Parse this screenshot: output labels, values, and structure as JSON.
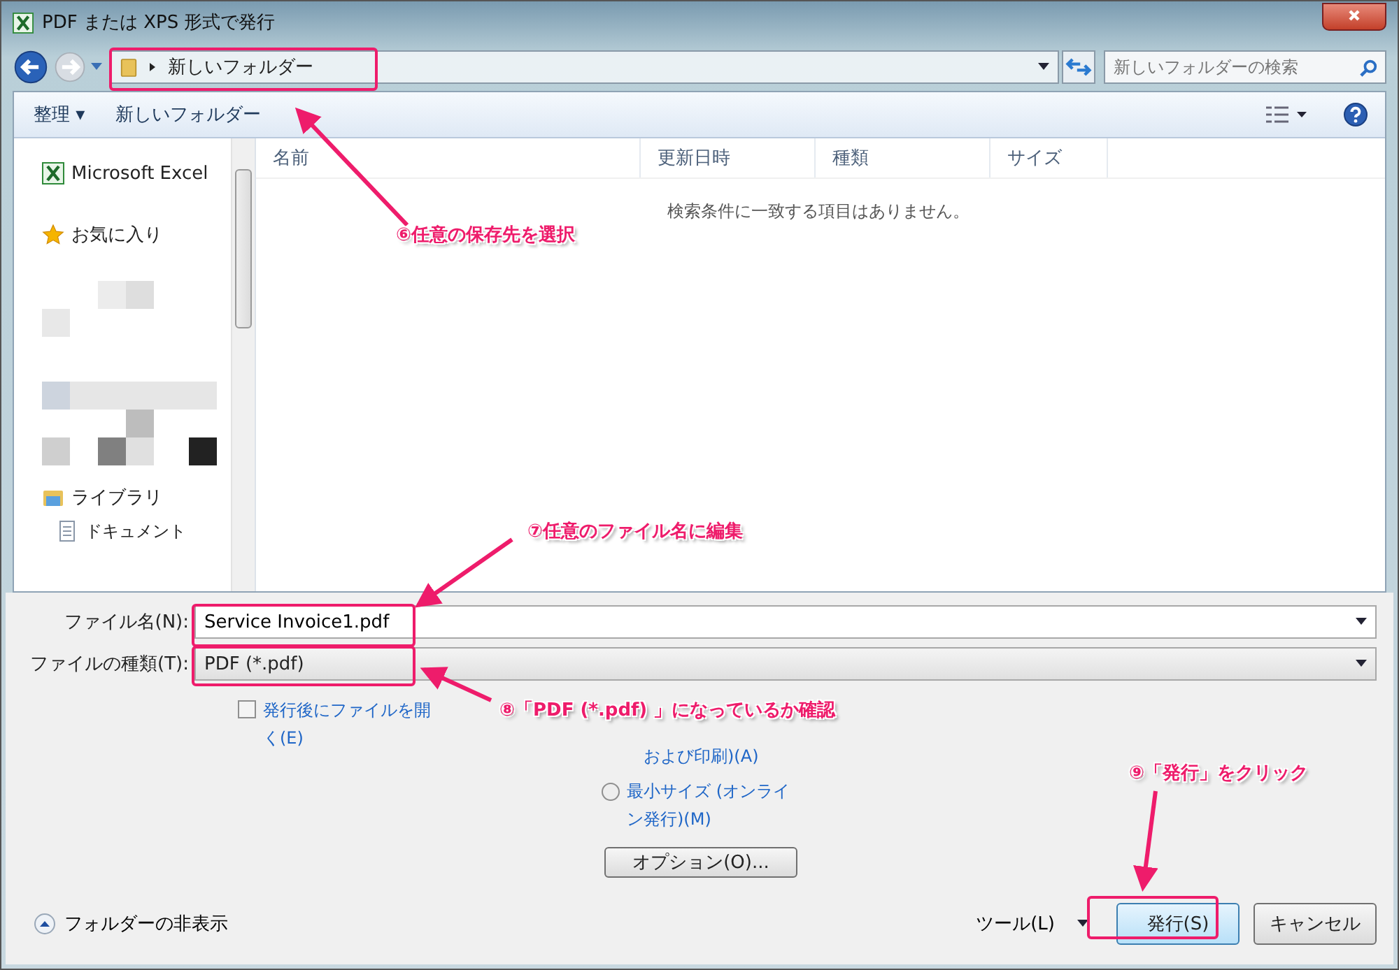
{
  "window": {
    "title": "PDF または XPS 形式で発行"
  },
  "address_bar": {
    "path": "新しいフォルダー",
    "search_placeholder": "新しいフォルダーの検索"
  },
  "toolbar": {
    "organize": "整理 ▾",
    "new_folder": "新しいフォルダー"
  },
  "sidebar": {
    "items": [
      {
        "label": "Microsoft Excel",
        "kind": "excel"
      },
      {
        "label": "お気に入り",
        "kind": "star"
      },
      {
        "label": "ライブラリ",
        "kind": "library"
      },
      {
        "label": "ドキュメント",
        "kind": "doc"
      }
    ]
  },
  "file_list": {
    "columns": [
      "名前",
      "更新日時",
      "種類",
      "サイズ"
    ],
    "empty_message": "検索条件に一致する項目はありません。"
  },
  "form": {
    "filename_label": "ファイル名(N):",
    "filename": "Service Invoice1.pdf",
    "type_label": "ファイルの種類(T):",
    "type": "PDF (*.pdf)"
  },
  "open_after": {
    "label": "発行後にファイルを開く(E)",
    "checked": false
  },
  "optimize": {
    "standard_tail": "および印刷)(A)",
    "options": [
      {
        "label": "最小サイズ (オンライン発行)(M)",
        "selected": false
      }
    ]
  },
  "buttons": {
    "options": "オプション(O)...",
    "hide_folders": "フォルダーの非表示",
    "tools": "ツール(L)",
    "publish": "発行(S)",
    "cancel": "キャンセル"
  },
  "annotations": [
    {
      "text": "⑥任意の保存先を選択"
    },
    {
      "text": "⑦任意のファイル名に編集"
    },
    {
      "text": "⑧「PDF (*.pdf) 」になっているか確認"
    },
    {
      "text": "⑨「発行」をクリック"
    }
  ]
}
